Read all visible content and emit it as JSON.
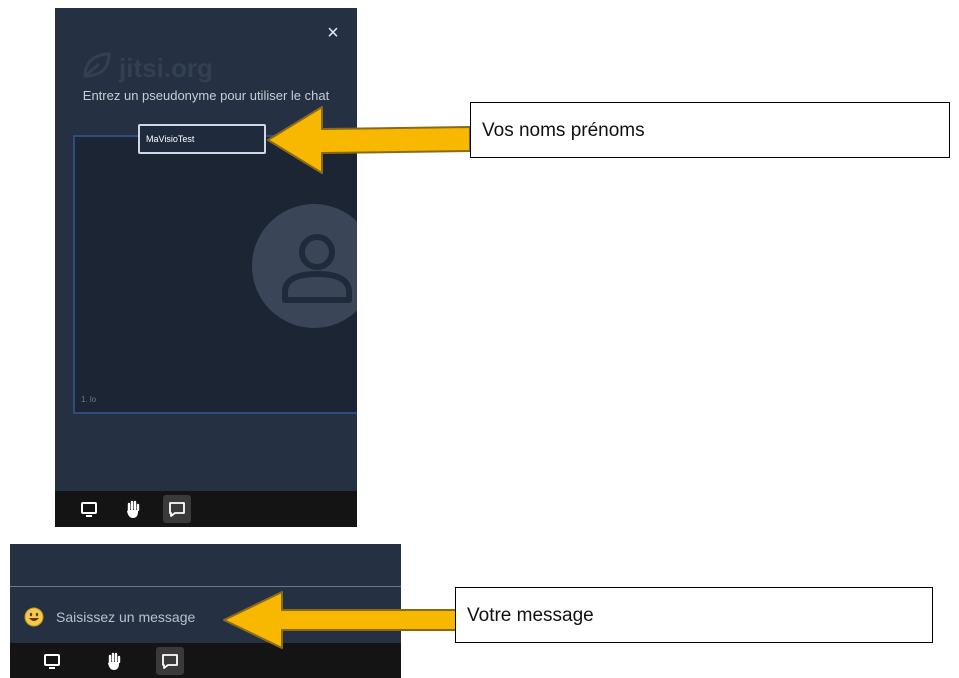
{
  "top_panel": {
    "watermark": "jitsi.org",
    "nickname_prompt": "Entrez un pseudonyme pour utiliser le chat",
    "nickname_value": "MaVisioTest",
    "tile_label": "1. lo",
    "close_icon": "×",
    "icons": [
      "close-icon",
      "avatar-icon",
      "screen-share-icon",
      "raise-hand-icon",
      "chat-icon"
    ]
  },
  "bottom_panel": {
    "message_placeholder": "Saisissez un message",
    "icons": [
      "emoji-icon",
      "screen-share-icon",
      "raise-hand-icon",
      "chat-icon"
    ]
  },
  "callouts": {
    "name_label": "Vos noms prénoms",
    "message_label": "Votre message"
  },
  "colors": {
    "panel_bg": "#253143",
    "toolbar_bg": "#141414",
    "arrow_fill": "#f8b800",
    "arrow_outline": "#8a6a1a",
    "active_button": "#3a3a3a"
  }
}
